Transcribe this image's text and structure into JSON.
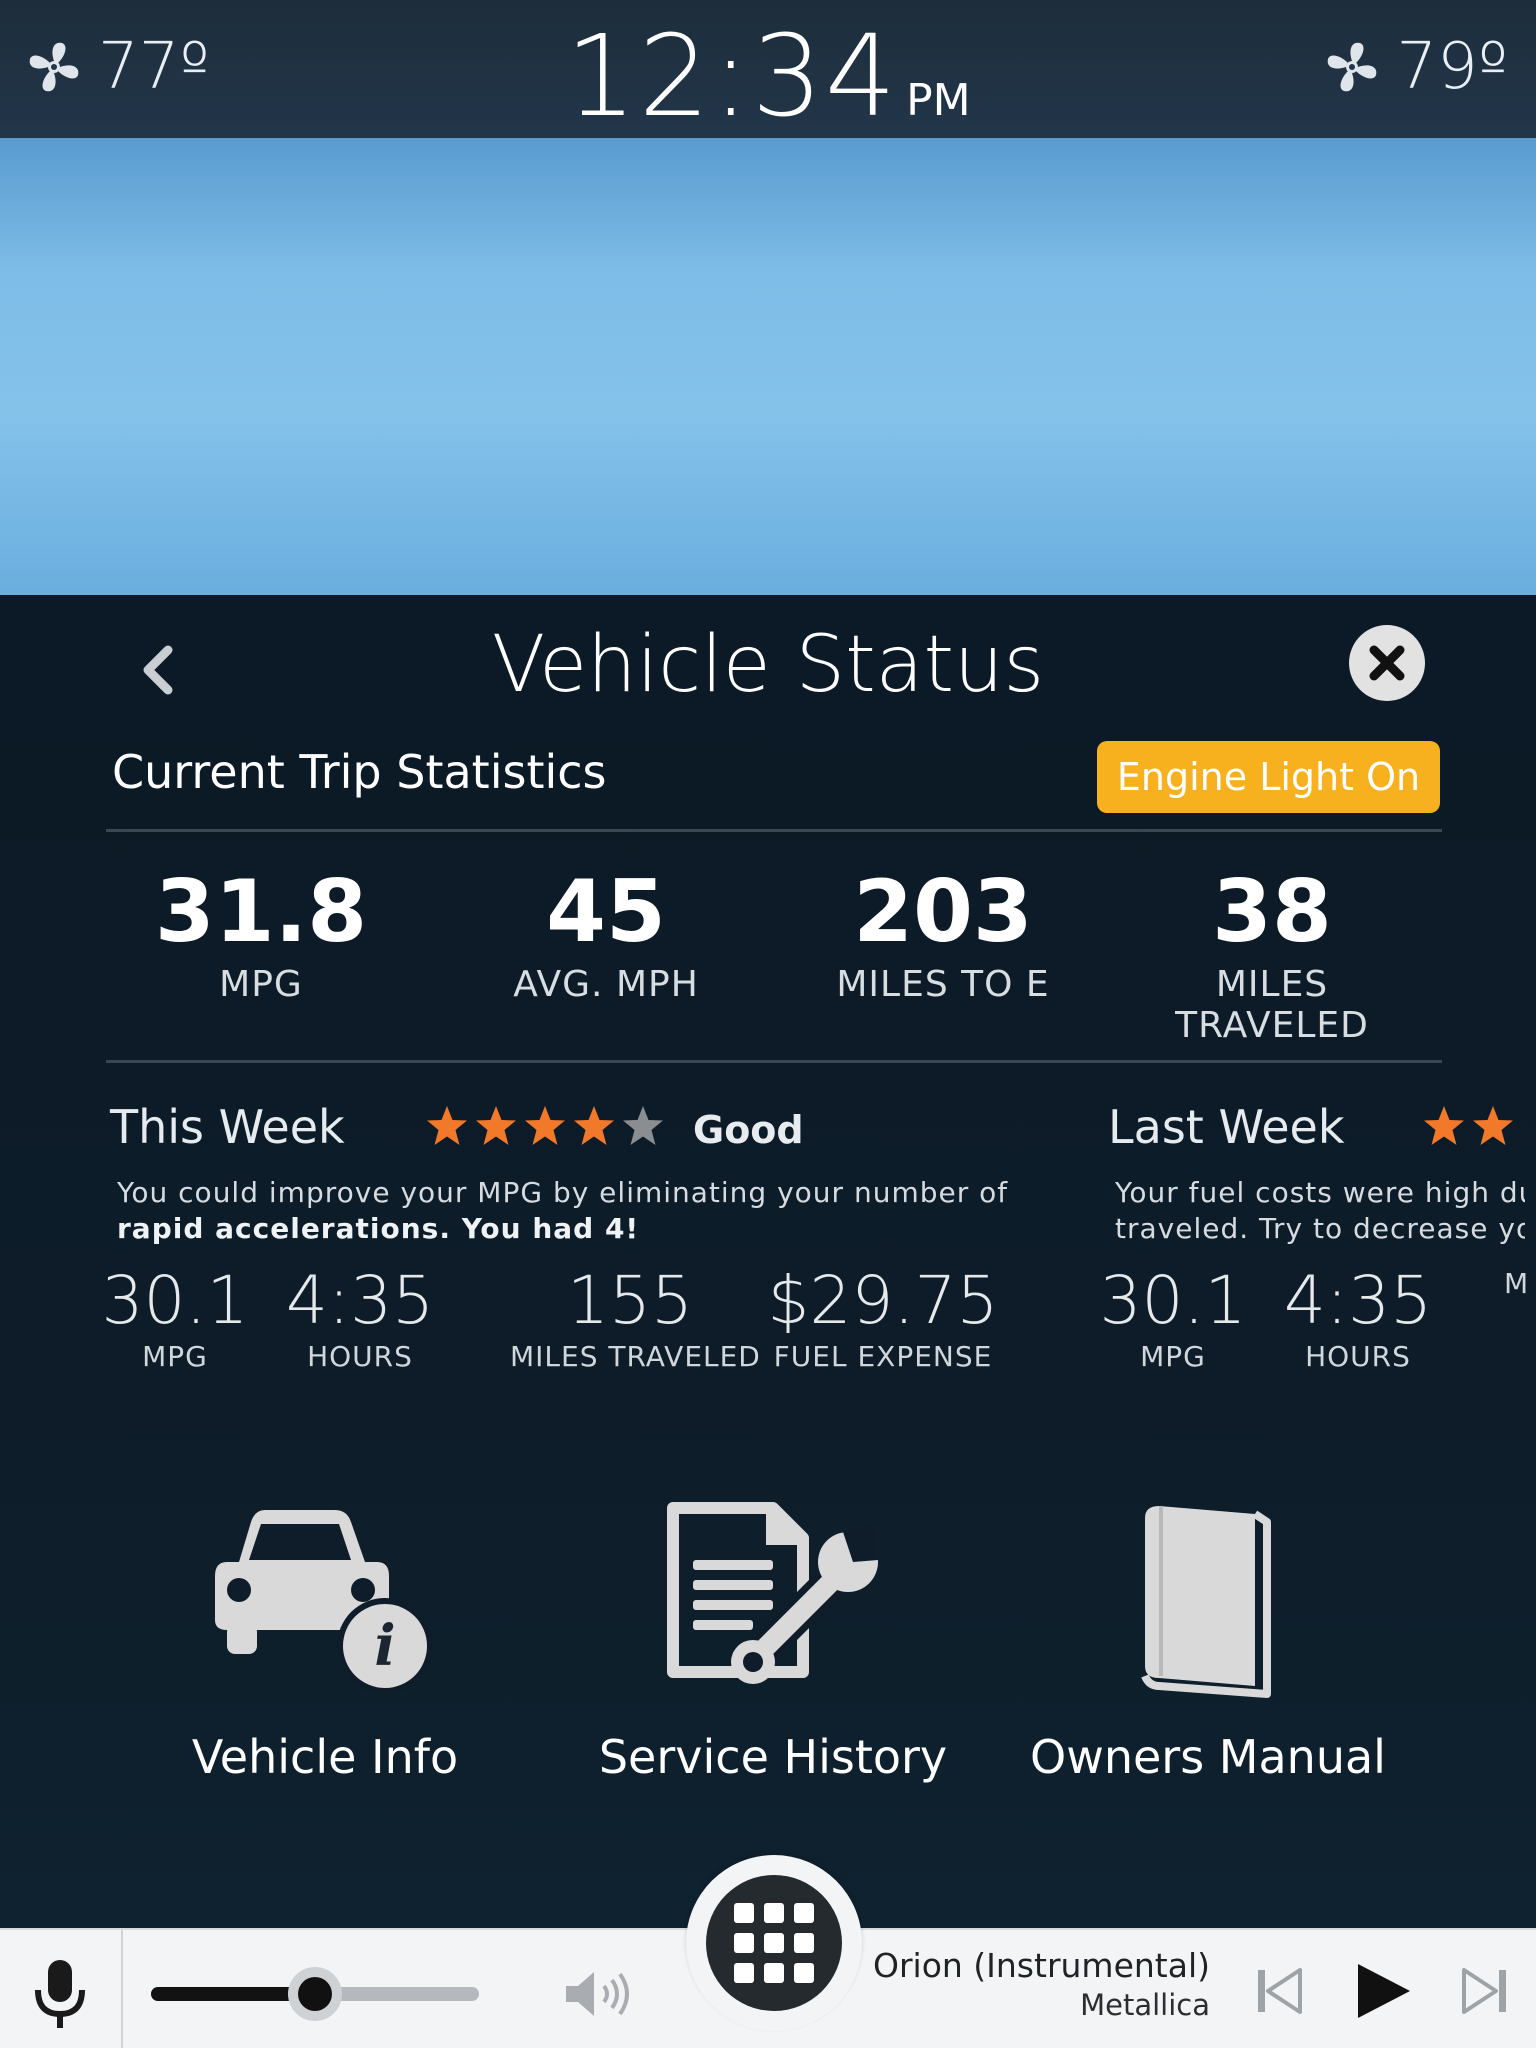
{
  "status_bar": {
    "left_temp": "77º",
    "clock_time": "12:34",
    "clock_ampm": "PM",
    "right_temp": "79º",
    "left_icon": "fan-icon",
    "right_icon": "fan-icon"
  },
  "panel": {
    "title": "Vehicle Status",
    "back_icon": "chevron-left-icon",
    "close_icon": "close-icon",
    "section_title": "Current Trip Statistics",
    "engine_badge": "Engine Light On",
    "engine_badge_color": "#f7b11e",
    "trip_stats": [
      {
        "value": "31.8",
        "label": "MPG"
      },
      {
        "value": "45",
        "label": "AVG. MPH"
      },
      {
        "value": "203",
        "label": "MILES TO E"
      },
      {
        "value": "38",
        "label": "MILES TRAVELED"
      }
    ]
  },
  "this_week": {
    "title": "This Week",
    "stars_filled": 4,
    "stars_total": 5,
    "rating_word": "Good",
    "tip_line1": "You could improve your MPG by eliminating your number of",
    "tip_line2_bold": "rapid accelerations. You had 4!",
    "stats": [
      {
        "value": "30.1",
        "label": "MPG"
      },
      {
        "value": "4:35",
        "label": "HOURS"
      },
      {
        "value": "155",
        "label": "MILES TRAVELED"
      },
      {
        "value": "$29.75",
        "label": "FUEL EXPENSE"
      }
    ]
  },
  "last_week": {
    "title": "Last Week",
    "stars_visible": 2,
    "tip_line1": "Your fuel costs were high due",
    "tip_line2": "traveled. Try to decrease your",
    "stats": [
      {
        "value": "30.1",
        "label": "MPG"
      },
      {
        "value": "4:35",
        "label": "HOURS"
      },
      {
        "value": "",
        "label": "M"
      }
    ]
  },
  "shortcuts": [
    {
      "label": "Vehicle Info",
      "icon": "car-info-icon"
    },
    {
      "label": "Service History",
      "icon": "document-wrench-icon"
    },
    {
      "label": "Owners Manual",
      "icon": "book-icon"
    }
  ],
  "bottom_bar": {
    "mic_icon": "microphone-icon",
    "volume_level": 0.5,
    "speaker_icon": "speaker-icon",
    "home_icon": "app-grid-icon",
    "track_title": "Orion (Instrumental)",
    "track_artist": "Metallica",
    "prev_icon": "skip-previous-icon",
    "play_icon": "play-icon",
    "next_icon": "skip-next-icon"
  },
  "colors": {
    "star_active": "#f2782a",
    "star_inactive": "#8a8e91",
    "panel_bg": "#0b1a26",
    "sky": "#84c2ea"
  }
}
